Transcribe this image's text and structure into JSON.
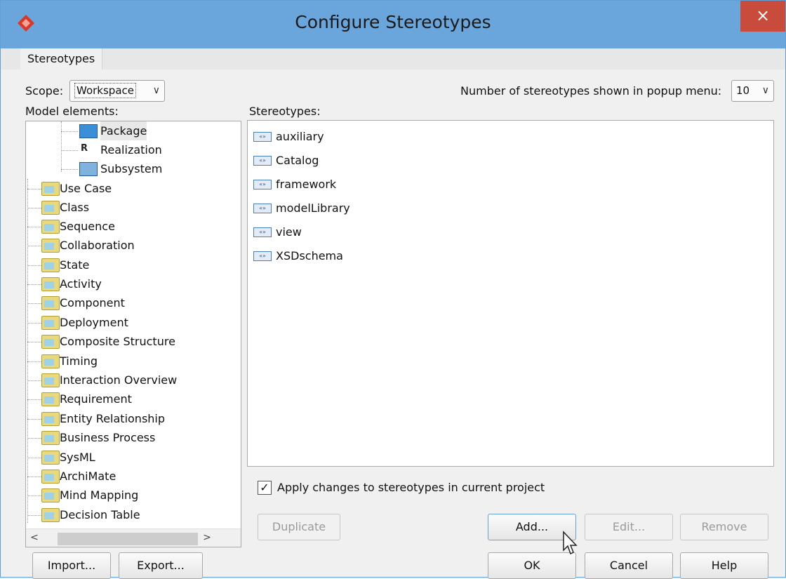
{
  "window": {
    "title": "Configure Stereotypes",
    "close": "×"
  },
  "tabs": [
    "Stereotypes"
  ],
  "scope": {
    "label": "Scope:",
    "value": "Workspace"
  },
  "popup_count": {
    "label": "Number of stereotypes shown in popup menu:",
    "value": "10"
  },
  "model_elements": {
    "label": "Model elements:",
    "children": [
      "Package",
      "Realization",
      "Subsystem"
    ],
    "folders": [
      "Use Case",
      "Class",
      "Sequence",
      "Collaboration",
      "State",
      "Activity",
      "Component",
      "Deployment",
      "Composite Structure",
      "Timing",
      "Interaction Overview",
      "Requirement",
      "Entity Relationship",
      "Business Process",
      "SysML",
      "ArchiMate",
      "Mind Mapping",
      "Decision Table"
    ]
  },
  "stereotypes": {
    "label": "Stereotypes:",
    "items": [
      "auxiliary",
      "Catalog",
      "framework",
      "modelLibrary",
      "view",
      "XSDschema"
    ]
  },
  "apply_changes": {
    "label": "Apply changes to stereotypes in current project",
    "checked": true
  },
  "buttons": {
    "duplicate": "Duplicate",
    "add": "Add...",
    "edit": "Edit...",
    "remove": "Remove",
    "import": "Import...",
    "export": "Export...",
    "ok": "OK",
    "cancel": "Cancel",
    "help": "Help"
  }
}
